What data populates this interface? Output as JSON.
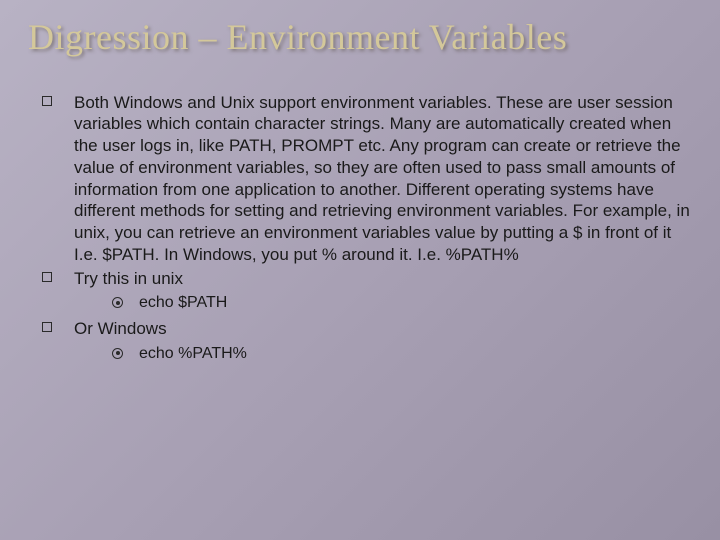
{
  "slide": {
    "title": "Digression – Environment Variables",
    "bullets": [
      {
        "text": "Both Windows and Unix support environment variables. These are user session variables which  contain character strings. Many are automatically created when the user logs in, like PATH, PROMPT etc. Any program can create or retrieve the value of environment variables, so they are often used to pass small amounts of information from one application to another. Different operating systems have different methods for setting and retrieving environment variables. For example,  in unix, you can retrieve an environment variables value  by putting a $ in front of it I.e. $PATH.  In Windows, you put % around it. I.e.  %PATH%"
      },
      {
        "text": "Try this in unix",
        "sub": [
          {
            "text": "echo $PATH"
          }
        ]
      },
      {
        "text": "Or Windows",
        "sub": [
          {
            "text": "echo  %PATH%"
          }
        ]
      }
    ]
  }
}
